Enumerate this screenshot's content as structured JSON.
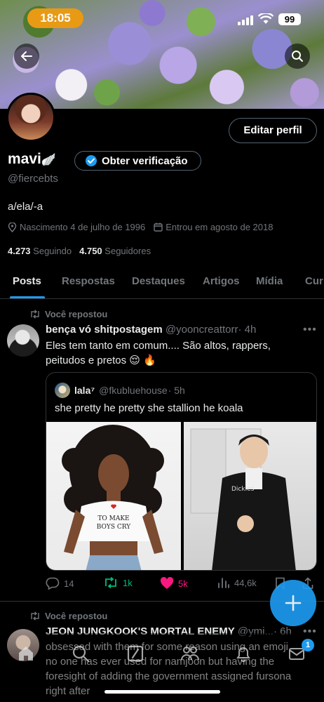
{
  "status_bar": {
    "time": "18:05",
    "battery": "99"
  },
  "profile": {
    "name": "mavi",
    "name_emoji": "🪽",
    "verify_label": "Obter verificação",
    "edit_label": "Editar perfil",
    "handle": "@fiercebts",
    "bio": "a/ela/-a",
    "birth": "Nascimento 4 de julho de 1996",
    "joined": "Entrou em agosto de 2018",
    "following_count": "4.273",
    "following_label": "Seguindo",
    "followers_count": "4.750",
    "followers_label": "Seguidores"
  },
  "tabs": [
    "Posts",
    "Respostas",
    "Destaques",
    "Artigos",
    "Mídia",
    "Cur"
  ],
  "posts": [
    {
      "repost_label": "Você repostou",
      "author": "bença vó shitpostagem",
      "handle": "@yooncreattorr",
      "time": "· 4h",
      "text_line1": "Eles tem tanto em comum.... São altos, rappers,",
      "text_line2": "peitudos e pretos 😌 🔥",
      "quote": {
        "author": "lala⁷",
        "handle": "@fkubluehouse",
        "time": "· 5h",
        "text": "she pretty he pretty she stallion he koala",
        "image1_shirt": "TO MAKE BOYS CRY",
        "image2_shirt": "Dickies"
      },
      "replies": "14",
      "reposts": "1k",
      "likes": "5k",
      "views": "44,6k"
    },
    {
      "repost_label": "Você repostou",
      "author": "JEON JUNGKOOK'S MORTAL ENEMY",
      "handle": "@ymi...",
      "time": "· 6h",
      "text_line1": "obsessed with them for some reason using an emoji",
      "text_line2": "no one has ever used for namjoon but having the",
      "text_line3": "foresight of adding the government assigned fursona",
      "text_line4": "right after"
    }
  ],
  "nav": {
    "badge": "1"
  },
  "colors": {
    "accent": "#1d9bf0",
    "like": "#f91880",
    "repost": "#00ba7c",
    "status_pill": "#e89a14"
  }
}
